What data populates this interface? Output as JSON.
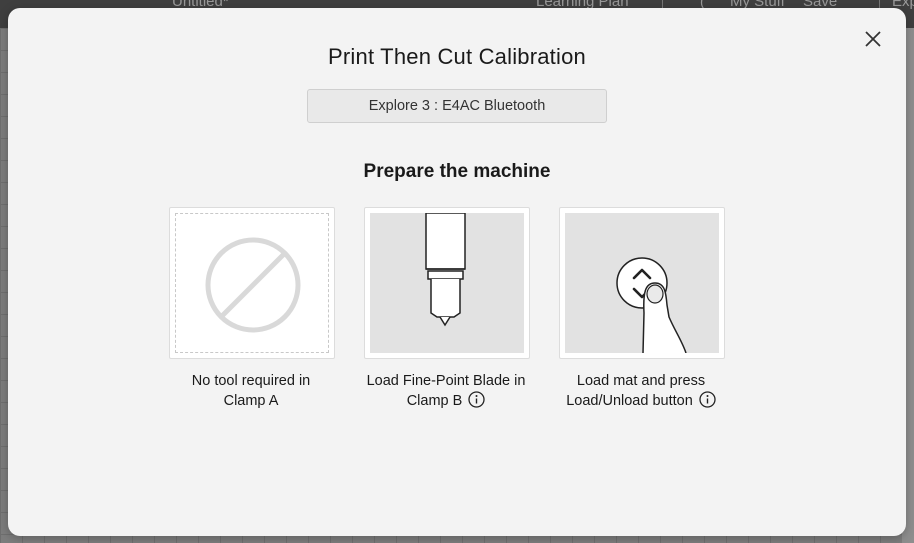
{
  "background_app": {
    "top_left_text": "Untitled*",
    "top_items": [
      "Learning Plan",
      "My Stuff",
      "Save",
      "Exp"
    ]
  },
  "modal": {
    "title": "Print Then Cut Calibration",
    "machine_select": "Explore 3 : E4AC Bluetooth",
    "section_heading": "Prepare the machine",
    "steps": [
      {
        "caption_line1": "No tool required in",
        "caption_line2": "Clamp A",
        "icon": "no-tool-icon",
        "has_info": false
      },
      {
        "caption_line1": "Load Fine-Point Blade in",
        "caption_line2": "Clamp B",
        "icon": "fine-point-blade-icon",
        "has_info": true
      },
      {
        "caption_line1": "Load mat and press",
        "caption_line2": "Load/Unload button",
        "icon": "load-unload-button-icon",
        "has_info": true
      }
    ]
  },
  "colors": {
    "modal_bg": "#f3f3f3",
    "card_bg": "#ffffff",
    "illustration_bg": "#e2e2e2",
    "text": "#1a1a1a"
  }
}
